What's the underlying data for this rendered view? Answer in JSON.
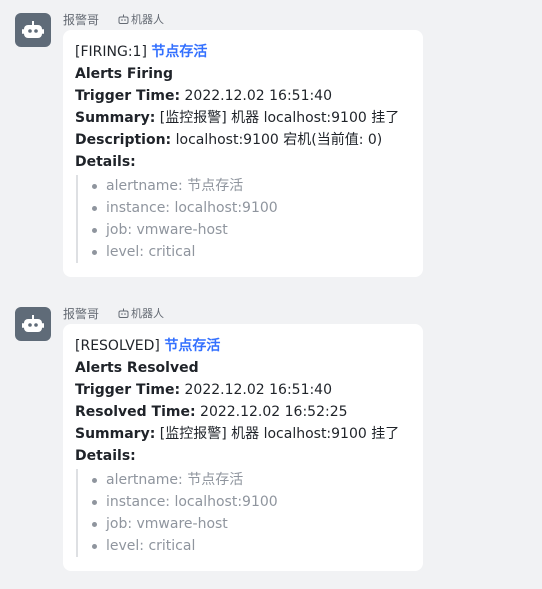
{
  "messages": [
    {
      "sender": "报警哥",
      "bot_tag": "机器人",
      "status_prefix": "[FIRING:1]",
      "status_link": "节点存活",
      "headline": "Alerts Firing",
      "fields": [
        {
          "label": "Trigger Time:",
          "value": "2022.12.02 16:51:40"
        },
        {
          "label": "Summary:",
          "value": "[监控报警] 机器 localhost:9100 挂了"
        },
        {
          "label": "Description:",
          "value": "localhost:9100 宕机(当前值: 0)"
        }
      ],
      "details_label": "Details:",
      "details": [
        "alertname: 节点存活",
        "instance: localhost:9100",
        "job: vmware-host",
        "level: critical"
      ]
    },
    {
      "sender": "报警哥",
      "bot_tag": "机器人",
      "status_prefix": "[RESOLVED]",
      "status_link": "节点存活",
      "headline": "Alerts Resolved",
      "fields": [
        {
          "label": "Trigger Time:",
          "value": "2022.12.02 16:51:40"
        },
        {
          "label": "Resolved Time:",
          "value": "2022.12.02 16:52:25"
        },
        {
          "label": "Summary:",
          "value": "[监控报警] 机器 localhost:9100 挂了"
        }
      ],
      "details_label": "Details:",
      "details": [
        "alertname: 节点存活",
        "instance: localhost:9100",
        "job: vmware-host",
        "level: critical"
      ]
    }
  ],
  "colors": {
    "link": "#3370ff",
    "avatar": "#5f6b78",
    "detail_text": "#8f959e"
  },
  "icons": {
    "avatar": "robot-icon",
    "bot_tag": "robot-tag-icon"
  }
}
